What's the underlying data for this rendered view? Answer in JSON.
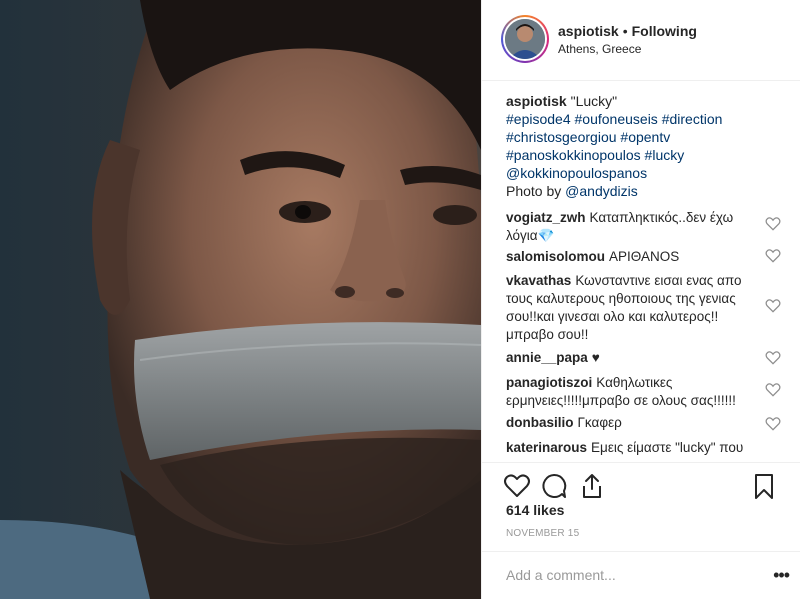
{
  "header": {
    "username": "aspiotisk",
    "separator": "•",
    "follow_status": "Following",
    "location": "Athens, Greece"
  },
  "caption": {
    "username": "aspiotisk",
    "title": "\"Lucky\"",
    "tags": [
      "#episode4",
      "#oufoneuseis",
      "#direction",
      "#christosgeorgiou",
      "#opentv",
      "#panoskokkinopoulos",
      "#lucky",
      "@kokkinopoulospanos"
    ],
    "photo_by_prefix": "Photo by",
    "photo_by_user": "@andydizis"
  },
  "comments": [
    {
      "user": "vogiatz_zwh",
      "text": "Καταπληκτικός..δεν έχω λόγια💎"
    },
    {
      "user": "salomisolomou",
      "text": "ΑΡΙΘΑΝΟS"
    },
    {
      "user": "vkavathas",
      "text": "Κωνσταντινε εισαι ενας απο τους καλυτερους ηθοποιους της γενιας σου!!και γινεσαι ολο και καλυτερος!!μπραβο σου!!"
    },
    {
      "user": "annie__papa",
      "text": "♥"
    },
    {
      "user": "panagiotiszoi",
      "text": "Καθηλωτικες ερμηνειες!!!!!μπραβο σε ολους σας!!!!!!"
    },
    {
      "user": "donbasilio",
      "text": "Γκαφερ"
    },
    {
      "user": "katerinarous",
      "text": "Εμεις είμαστε \"lucky\" που"
    }
  ],
  "actions": {
    "like_icon": "heart-outline-icon",
    "comment_icon": "comment-bubble-icon",
    "share_icon": "share-upload-icon",
    "save_icon": "bookmark-icon"
  },
  "likes": "614 likes",
  "date": "NOVEMBER 15",
  "comment_box": {
    "placeholder": "Add a comment...",
    "more_label": "•••"
  },
  "colors": {
    "text": "#262626",
    "hashtag": "#003569",
    "muted": "#999999",
    "divider": "#efefef"
  }
}
